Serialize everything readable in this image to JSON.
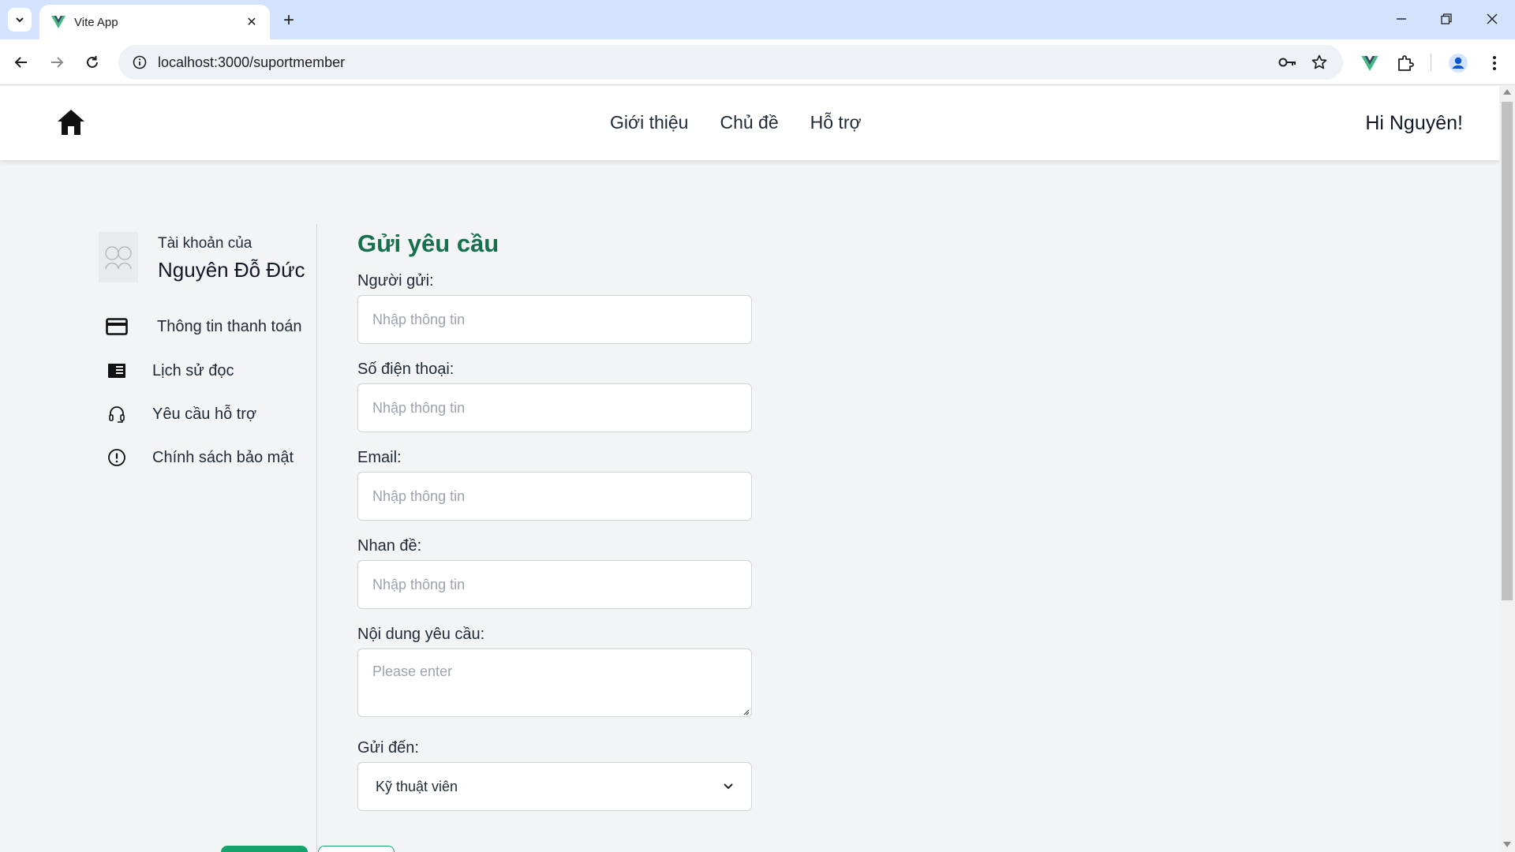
{
  "browser": {
    "tab_title": "Vite App",
    "url": "localhost:3000/suportmember",
    "favicon": "vue-v-icon",
    "accent_color": "#42b883"
  },
  "header": {
    "nav": [
      "Giới thiệu",
      "Chủ đề",
      "Hỗ trợ"
    ],
    "greeting": "Hi Nguyên!"
  },
  "sidebar": {
    "account_label": "Tài khoản của",
    "account_name": "Nguyên Đỗ Đức",
    "items": [
      {
        "label": "Thông tin thanh toán",
        "icon": "credit-card-icon"
      },
      {
        "label": "Lịch sử đọc",
        "icon": "book-icon"
      },
      {
        "label": "Yêu cầu hỗ trợ",
        "icon": "headset-icon"
      },
      {
        "label": "Chính sách bảo mật",
        "icon": "info-circle-icon"
      }
    ]
  },
  "form": {
    "title": "Gửi yêu cầu",
    "title_color": "#16704c",
    "fields": [
      {
        "label": "Người gửi:",
        "placeholder": "Nhập thông tin"
      },
      {
        "label": "Số điện thoại:",
        "placeholder": "Nhập thông tin"
      },
      {
        "label": "Email:",
        "placeholder": "Nhập thông tin"
      },
      {
        "label": "Nhan đề:",
        "placeholder": "Nhập thông tin"
      }
    ],
    "content": {
      "label": "Nội dung yêu cầu:",
      "placeholder": "Please enter"
    },
    "send_to": {
      "label": "Gửi đến:",
      "selected": "Kỹ thuật viên"
    },
    "button_color": "#16a36b"
  }
}
